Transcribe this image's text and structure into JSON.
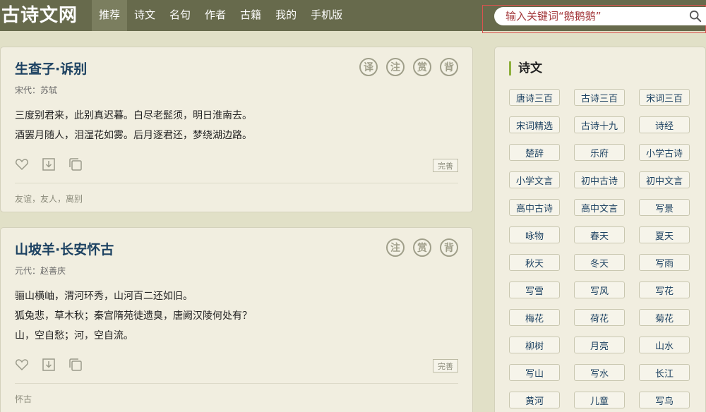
{
  "site": {
    "logo": "古诗文网"
  },
  "nav": [
    {
      "label": "推荐",
      "active": true
    },
    {
      "label": "诗文"
    },
    {
      "label": "名句"
    },
    {
      "label": "作者"
    },
    {
      "label": "古籍"
    },
    {
      "label": "我的"
    },
    {
      "label": "手机版"
    }
  ],
  "search": {
    "placeholder": "输入关键词“鹅鹅鹅”",
    "icon": "search-icon"
  },
  "poems": [
    {
      "title": "生查子·诉别",
      "meta": "宋代：苏轼",
      "badges": [
        "译",
        "注",
        "赏",
        "背"
      ],
      "lines": [
        "三度别君来，此别真迟暮。白尽老髭须，明日淮南去。",
        "酒罢月随人，泪湿花如雾。后月逐君还，梦绕湖边路。"
      ],
      "perfect_label": "完善",
      "tags": "友谊，友人，离别"
    },
    {
      "title": "山坡羊·长安怀古",
      "meta": "元代：赵善庆",
      "badges": [
        "注",
        "赏",
        "背"
      ],
      "lines": [
        "骊山横岫，渭河环秀，山河百二还如旧。",
        "狐兔悲，草木秋；秦宫隋苑徒遗臭，唐阙汉陵何处有？",
        "山，空自愁；河，空自流。"
      ],
      "perfect_label": "完善",
      "tags": "怀古"
    }
  ],
  "sidebar": {
    "title": "诗文",
    "tags": [
      "唐诗三百",
      "古诗三百",
      "宋词三百",
      "宋词精选",
      "古诗十九",
      "诗经",
      "楚辞",
      "乐府",
      "小学古诗",
      "小学文言",
      "初中古诗",
      "初中文言",
      "高中古诗",
      "高中文言",
      "写景",
      "咏物",
      "春天",
      "夏天",
      "秋天",
      "冬天",
      "写雨",
      "写雪",
      "写风",
      "写花",
      "梅花",
      "荷花",
      "菊花",
      "柳树",
      "月亮",
      "山水",
      "写山",
      "写水",
      "长江",
      "黄河",
      "儿童",
      "写鸟"
    ]
  },
  "colors": {
    "header": "#676a4c",
    "background": "#e1e0c7",
    "card": "#f1eee0",
    "title": "#1d4262",
    "accent": "#8fb03e"
  }
}
